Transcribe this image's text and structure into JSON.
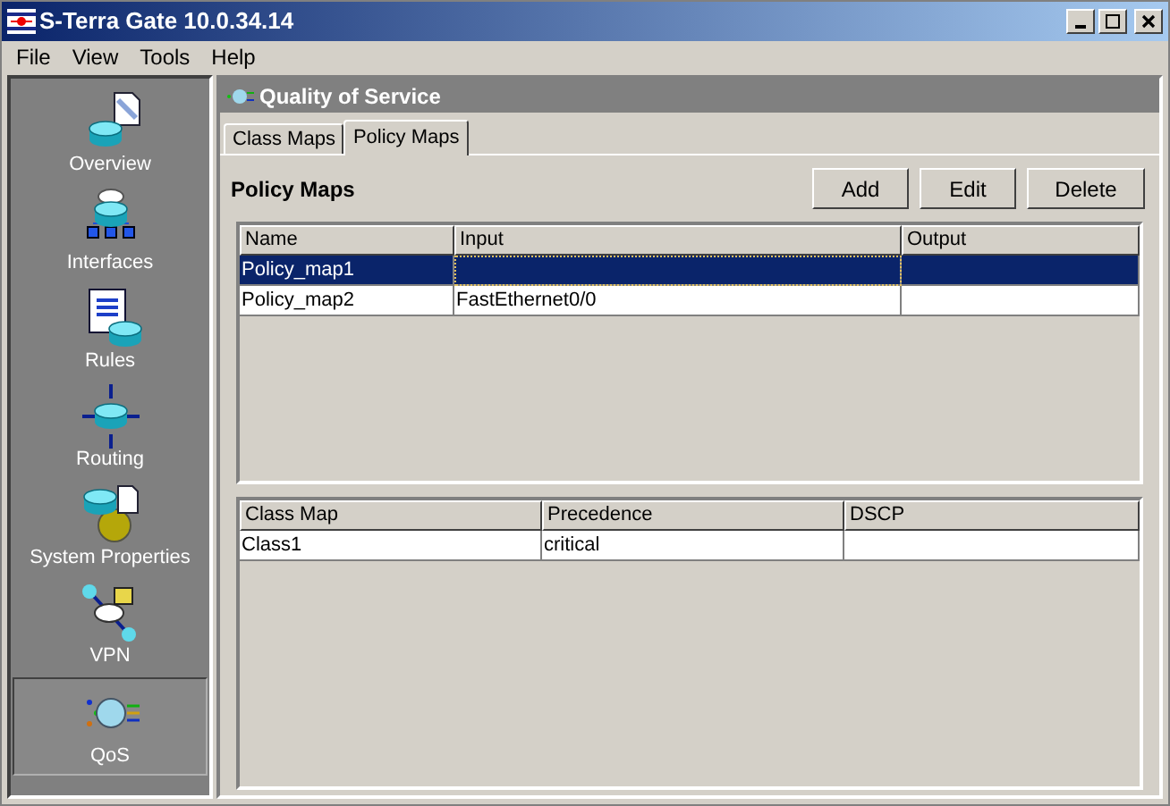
{
  "window": {
    "title": "S-Terra Gate 10.0.34.14"
  },
  "menu": [
    "File",
    "View",
    "Tools",
    "Help"
  ],
  "sidebar": {
    "items": [
      {
        "label": "Overview",
        "selected": false
      },
      {
        "label": "Interfaces",
        "selected": false
      },
      {
        "label": "Rules",
        "selected": false
      },
      {
        "label": "Routing",
        "selected": false
      },
      {
        "label": "System Properties",
        "selected": false
      },
      {
        "label": "VPN",
        "selected": false
      },
      {
        "label": "QoS",
        "selected": true
      }
    ]
  },
  "panel": {
    "title": "Quality of Service"
  },
  "tabs": [
    {
      "label": "Class Maps",
      "selected": false
    },
    {
      "label": "Policy Maps",
      "selected": true
    }
  ],
  "section": {
    "title": "Policy Maps",
    "buttons": [
      "Add",
      "Edit",
      "Delete"
    ]
  },
  "policy_table": {
    "columns": [
      "Name",
      "Input",
      "Output"
    ],
    "rows": [
      {
        "cells": [
          "Policy_map1",
          "",
          ""
        ],
        "selected": true
      },
      {
        "cells": [
          "Policy_map2",
          "FastEthernet0/0",
          ""
        ],
        "selected": false
      }
    ]
  },
  "class_table": {
    "columns": [
      "Class Map",
      "Precedence",
      "DSCP"
    ],
    "rows": [
      {
        "cells": [
          "Class1",
          "critical",
          ""
        ],
        "selected": false
      }
    ]
  }
}
